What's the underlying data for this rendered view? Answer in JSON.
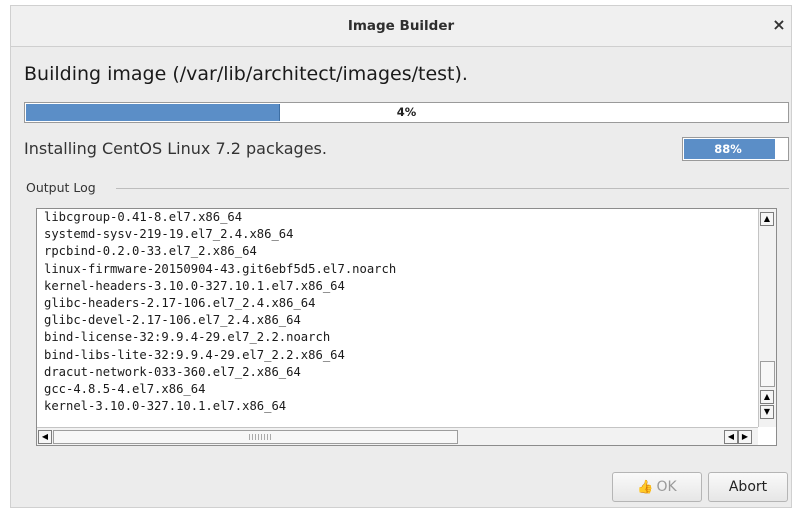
{
  "window": {
    "title": "Image Builder",
    "close_glyph": "×",
    "close_icon": "close-icon"
  },
  "heading": "Building image (/var/lib/architect/images/test).",
  "overall_progress": {
    "value": 0.04,
    "label": "4%"
  },
  "status": {
    "text": "Installing CentOS Linux 7.2 packages.",
    "progress": {
      "value": 0.88,
      "label": "88%"
    }
  },
  "output_log": {
    "label": "Output Log",
    "lines": [
      "libcgroup-0.41-8.el7.x86_64",
      "systemd-sysv-219-19.el7_2.4.x86_64",
      "rpcbind-0.2.0-33.el7_2.x86_64",
      "linux-firmware-20150904-43.git6ebf5d5.el7.noarch",
      "kernel-headers-3.10.0-327.10.1.el7.x86_64",
      "glibc-headers-2.17-106.el7_2.4.x86_64",
      "glibc-devel-2.17-106.el7_2.4.x86_64",
      "bind-license-32:9.9.4-29.el7_2.2.noarch",
      "bind-libs-lite-32:9.9.4-29.el7_2.2.x86_64",
      "dracut-network-033-360.el7_2.x86_64",
      "gcc-4.8.5-4.el7.x86_64",
      "kernel-3.10.0-327.10.1.el7.x86_64"
    ]
  },
  "buttons": {
    "ok": "OK",
    "ok_icon": "thumbs-up-icon",
    "abort": "Abort"
  },
  "colors": {
    "progress_fill": "#5b8ec7"
  }
}
